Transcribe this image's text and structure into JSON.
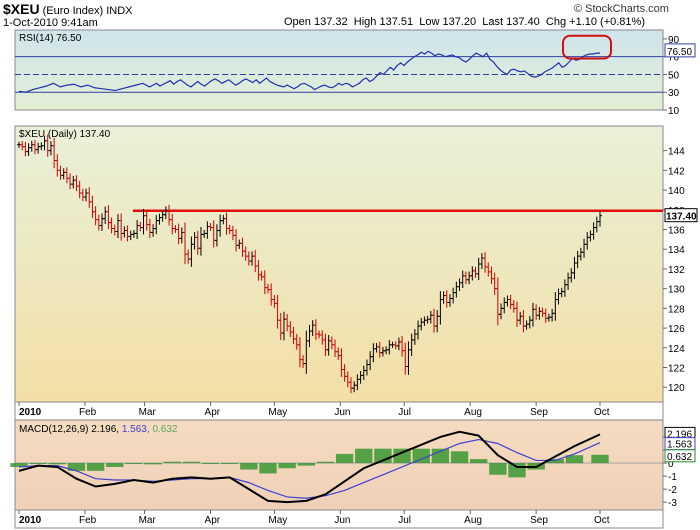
{
  "header": {
    "symbol": "$XEU",
    "name": "(Euro Index)",
    "exchange": "INDX",
    "date": "1-Oct-2010 9:41am",
    "open_label": "Open",
    "open": "137.32",
    "high_label": "High",
    "high": "137.51",
    "low_label": "Low",
    "low": "137.20",
    "last_label": "Last",
    "last": "137.40",
    "chg_label": "Chg",
    "chg": "+1.10 (+0.81%)",
    "copyright": "© StockCharts.com"
  },
  "chart_data": [
    {
      "type": "line",
      "panel": "RSI",
      "title": "RSI(14) 76.50",
      "current_label": "76.50",
      "ylim": [
        10,
        100
      ],
      "ticks": [
        10,
        30,
        50,
        70,
        90
      ],
      "levels": [
        30,
        50,
        70
      ],
      "x_day": [
        0,
        14,
        28,
        42,
        56,
        70,
        84,
        98,
        112,
        126,
        140,
        154,
        168,
        182,
        196,
        210,
        224,
        238,
        252,
        266,
        273,
        280,
        287,
        294,
        301,
        308,
        315,
        322,
        329,
        336,
        343,
        350,
        357,
        364,
        371,
        378,
        385,
        392,
        399,
        406,
        413,
        420,
        427,
        434,
        441,
        448,
        455,
        462,
        469,
        476,
        483,
        490,
        497,
        504,
        511,
        518,
        525,
        532,
        539,
        546,
        553,
        560,
        567,
        574,
        581,
        588,
        595,
        602,
        609,
        616,
        623,
        630,
        637,
        644,
        651,
        658,
        665,
        672,
        679,
        686,
        693,
        700,
        707,
        714,
        721,
        728,
        735,
        742,
        749,
        756,
        763,
        770,
        777,
        784,
        791,
        798,
        805,
        812,
        819,
        826,
        833,
        840,
        847,
        854,
        861,
        868,
        875,
        882,
        889,
        896,
        903,
        910,
        917,
        924,
        931,
        938,
        945,
        952,
        959,
        966,
        973,
        980,
        987,
        994,
        1001,
        1008,
        1015,
        1022,
        1029,
        1036,
        1043,
        1050,
        1057,
        1064,
        1071,
        1078,
        1085,
        1092,
        1099,
        1106,
        1113,
        1120,
        1127,
        1134,
        1141,
        1148,
        1155,
        1162,
        1169,
        1176,
        1183
      ],
      "values": [
        31,
        30,
        33,
        35,
        37,
        40,
        36,
        38,
        39,
        36,
        38,
        35,
        34,
        33,
        32,
        34,
        36,
        38,
        40,
        36,
        38,
        40,
        37,
        39,
        41,
        43,
        39,
        42,
        44,
        41,
        38,
        36,
        39,
        42,
        39,
        37,
        40,
        43,
        45,
        43,
        40,
        42,
        44,
        41,
        38,
        40,
        43,
        45,
        43,
        41,
        44,
        40,
        43,
        46,
        42,
        40,
        38,
        37,
        36,
        38,
        36,
        34,
        36,
        39,
        40,
        38,
        36,
        33,
        35,
        37,
        38,
        36,
        35,
        37,
        40,
        38,
        40,
        39,
        36,
        38,
        40,
        44,
        46,
        42,
        44,
        48,
        52,
        50,
        54,
        58,
        55,
        60,
        63,
        60,
        64,
        67,
        70,
        72,
        75,
        73,
        76,
        74,
        71,
        73,
        72,
        70,
        71,
        72,
        70,
        69,
        66,
        64,
        67,
        71,
        74,
        72,
        70,
        74,
        67,
        64,
        59,
        55,
        52,
        50,
        55,
        56,
        54,
        53,
        54,
        51,
        48,
        47,
        48,
        50,
        53,
        55,
        57,
        60,
        63,
        58,
        60,
        64,
        68,
        66,
        67,
        70,
        72,
        73,
        73,
        74,
        74,
        75,
        76,
        76,
        75,
        77,
        78,
        78,
        78,
        77,
        77,
        78,
        76.5
      ]
    },
    {
      "type": "ohlc",
      "panel": "Price",
      "title": "$XEU (Daily) 137.40",
      "current_label": "137.40",
      "ylim": [
        118.5,
        146.5
      ],
      "ticks": [
        120,
        122,
        124,
        126,
        128,
        130,
        132,
        134,
        136,
        138,
        140,
        142,
        144
      ],
      "resistance": 137.9,
      "x_labels": [
        "2010",
        "Feb",
        "Mar",
        "Apr",
        "May",
        "Jun",
        "Jul",
        "Aug",
        "Sep",
        "Oct"
      ],
      "x_label_day": [
        0,
        31,
        59,
        90,
        120,
        151,
        181,
        212,
        243,
        273
      ],
      "closes": [
        144.6,
        144.4,
        143.9,
        144.3,
        144.6,
        144.1,
        144.4,
        144.5,
        145,
        144,
        144.5,
        143,
        142,
        141.5,
        141.8,
        141.2,
        140.6,
        141,
        140.4,
        139.7,
        139.3,
        139.7,
        138.8,
        137.8,
        137,
        136.4,
        137.1,
        137.8,
        136.7,
        136.1,
        135.8,
        136.9,
        135.6,
        135.9,
        135.3,
        135.5,
        135.6,
        136.4,
        136.2,
        137.4,
        136.5,
        135.7,
        136.1,
        136.9,
        137.2,
        137.5,
        137.9,
        137,
        136.1,
        136,
        135.1,
        135.7,
        133.5,
        133,
        134.5,
        135.2,
        134.1,
        135.5,
        135.6,
        136.3,
        136.2,
        134.9,
        135.9,
        136.9,
        137.1,
        136.1,
        135.9,
        135.4,
        134.4,
        134.6,
        133.8,
        133.3,
        132.8,
        133.3,
        132.3,
        131.4,
        131.2,
        130.1,
        129.9,
        128.9,
        128.5,
        126.8,
        125.5,
        126.9,
        126.2,
        125.6,
        124.9,
        124.3,
        122.8,
        122.4,
        124.7,
        125.7,
        126.3,
        125.4,
        125.3,
        124.8,
        123.8,
        124.7,
        124.3,
        123.6,
        123.2,
        121.8,
        121.1,
        120.5,
        119.9,
        120.2,
        120.8,
        121.2,
        121.7,
        122.3,
        123.1,
        123.9,
        124.1,
        123.5,
        123.7,
        123.8,
        124.3,
        124.3,
        124.2,
        124.6,
        123.7,
        122.1,
        123.8,
        124.8,
        125.4,
        126.2,
        126.6,
        126.8,
        126.9,
        127.3,
        126.2,
        127.2,
        128.9,
        129.3,
        128.6,
        129,
        129.6,
        130.2,
        130.6,
        131.3,
        130.9,
        131.3,
        131.8,
        131.5,
        132.5,
        133.1,
        132.2,
        131.7,
        131,
        130,
        127.4,
        128,
        128.6,
        128.9,
        128.4,
        128,
        126.8,
        127.2,
        126.2,
        126.4,
        126.8,
        127.9,
        127.3,
        127.7,
        127.5,
        127,
        127.1,
        127.5,
        128.9,
        129.5,
        129.7,
        130.4,
        131.1,
        131.6,
        132.6,
        133.3,
        133.7,
        134.5,
        135.2,
        135.5,
        136.2,
        136.8,
        137.4
      ]
    },
    {
      "type": "line",
      "panel": "MACD",
      "title": "MACD(12,26,9)",
      "macd_label": "2.196",
      "signal_label": "1.563",
      "hist_label": "0.632",
      "ylim": [
        -3.6,
        3.3
      ],
      "ticks": [
        -3,
        -2,
        -1,
        0,
        1,
        2
      ],
      "x_labels": [
        "2010",
        "Feb",
        "Mar",
        "Apr",
        "May",
        "Jun",
        "Jul",
        "Aug",
        "Sep",
        "Oct"
      ],
      "x_label_day": [
        0,
        31,
        59,
        90,
        120,
        151,
        181,
        212,
        243,
        273
      ],
      "days": [
        0,
        9,
        18,
        27,
        36,
        45,
        54,
        63,
        72,
        81,
        90,
        99,
        108,
        117,
        126,
        135,
        144,
        153,
        162,
        171,
        180,
        189,
        198,
        207,
        216,
        225,
        234,
        243,
        252,
        261,
        273
      ],
      "macd": [
        -0.6,
        -0.2,
        -0.3,
        -1.2,
        -1.8,
        -1.6,
        -1.3,
        -1.5,
        -1.2,
        -1.1,
        -1.2,
        -1.1,
        -2.0,
        -2.9,
        -3.0,
        -2.9,
        -2.4,
        -1.4,
        -0.4,
        0.2,
        0.8,
        1.4,
        2.0,
        2.4,
        2.1,
        0.6,
        -0.3,
        -0.3,
        0.5,
        1.3,
        2.196
      ],
      "signal": [
        -0.3,
        -0.2,
        -0.2,
        -0.6,
        -1.2,
        -1.3,
        -1.3,
        -1.4,
        -1.3,
        -1.2,
        -1.2,
        -1.1,
        -1.5,
        -2.1,
        -2.6,
        -2.7,
        -2.5,
        -2.1,
        -1.5,
        -0.9,
        -0.3,
        0.3,
        0.9,
        1.5,
        1.8,
        1.5,
        0.8,
        0.2,
        0.2,
        0.7,
        1.563
      ],
      "histogram": [
        -0.3,
        0,
        -0.1,
        -0.6,
        -0.6,
        -0.3,
        0,
        -0.1,
        0.1,
        0.1,
        0,
        0,
        -0.5,
        -0.8,
        -0.4,
        -0.2,
        0.1,
        0.7,
        1.1,
        1.1,
        1.1,
        1.1,
        1.1,
        0.9,
        0.3,
        -0.9,
        -1.1,
        -0.5,
        0.3,
        0.6,
        0.632
      ],
      "colors": {
        "macd": "#000000",
        "signal": "#4040d0",
        "histogram": "#1f8f1f"
      }
    }
  ]
}
